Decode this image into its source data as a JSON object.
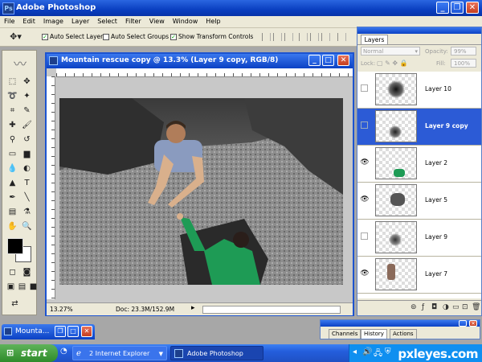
{
  "app": {
    "title": "Adobe Photoshop"
  },
  "menu": [
    "File",
    "Edit",
    "Image",
    "Layer",
    "Select",
    "Filter",
    "View",
    "Window",
    "Help"
  ],
  "options": {
    "auto_select_layer": {
      "label": "Auto Select Layer",
      "checked": true
    },
    "auto_select_groups": {
      "label": "Auto Select Groups",
      "checked": false
    },
    "show_transform_controls": {
      "label": "Show Transform Controls",
      "checked": true
    }
  },
  "document": {
    "title": "Mountain rescue copy @ 13.3% (Layer 9 copy, RGB/8)",
    "zoom": "13.27%",
    "doc_size": "Doc: 23.3M/152.9M"
  },
  "layers_panel": {
    "tab": "Layers",
    "blend_mode": "Normal",
    "opacity_label": "Opacity:",
    "opacity_value": "99%",
    "lock_label": "Lock:",
    "fill_label": "Fill:",
    "fill_value": "100%",
    "layers": [
      {
        "name": "Layer 10",
        "visible": false,
        "selected": false
      },
      {
        "name": "Layer 9 copy",
        "visible": false,
        "selected": true
      },
      {
        "name": "Layer 2",
        "visible": true,
        "selected": false
      },
      {
        "name": "Layer 5",
        "visible": true,
        "selected": false
      },
      {
        "name": "Layer 9",
        "visible": false,
        "selected": false
      },
      {
        "name": "Layer 7",
        "visible": true,
        "selected": false
      }
    ]
  },
  "bottom_panel": {
    "tabs": [
      "Channels",
      "History",
      "Actions"
    ],
    "active_tab": "History"
  },
  "minimized_window": {
    "label": "Mounta..."
  },
  "taskbar": {
    "start": "start",
    "items": [
      {
        "label": "2 Internet Explorer",
        "active": false
      },
      {
        "label": "Adobe Photoshop",
        "active": true
      }
    ],
    "watermark": "pxleyes.com"
  },
  "colors": {
    "xp_blue": "#0b41c4",
    "selection": "#2c5bd6",
    "panel_bg": "#ece9d8",
    "start_green": "#2e8b2a"
  }
}
